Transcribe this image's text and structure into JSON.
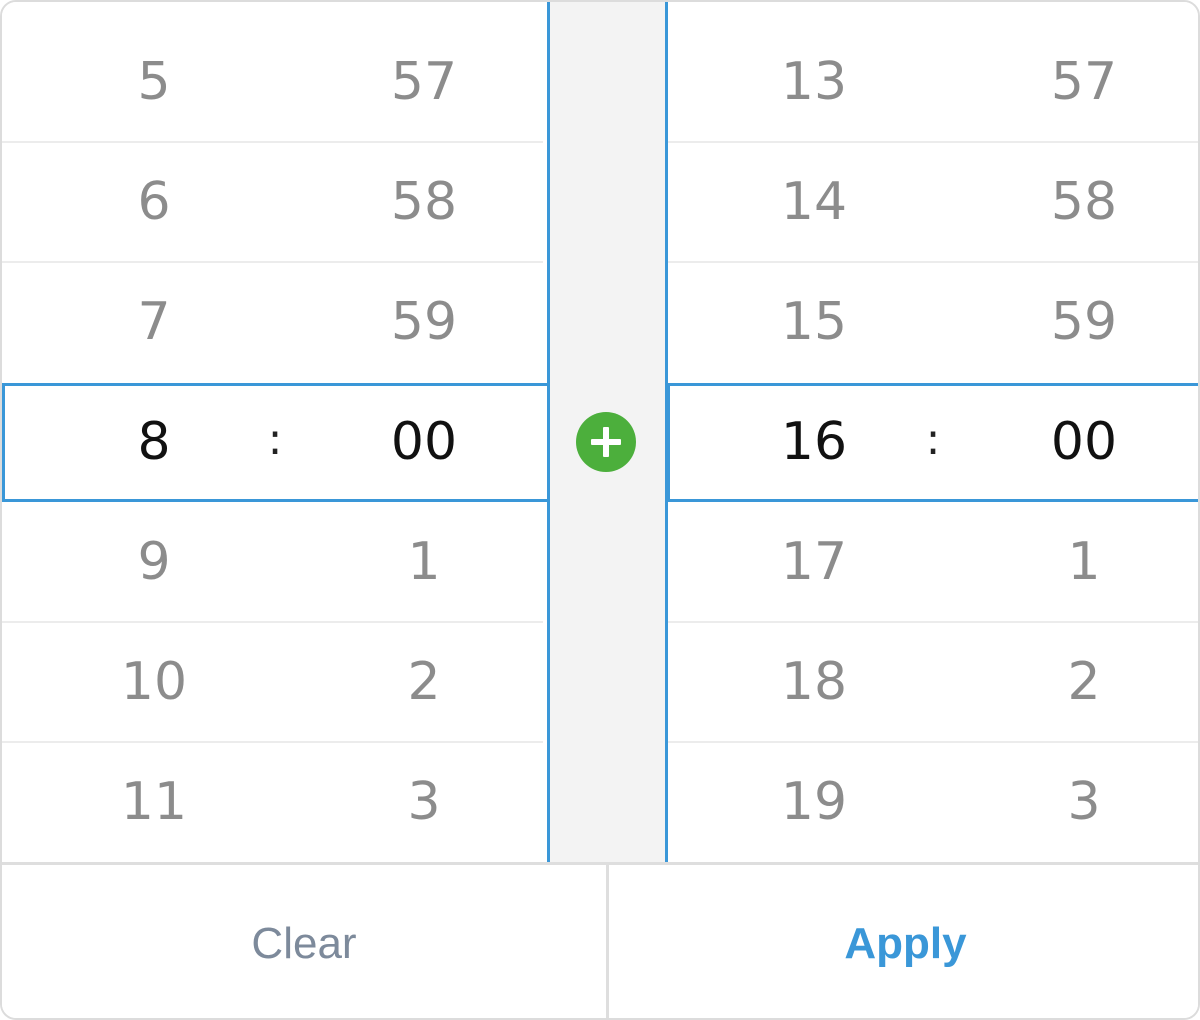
{
  "start_time": {
    "hours_above": [
      "5",
      "6",
      "7"
    ],
    "minutes_above": [
      "57",
      "58",
      "59"
    ],
    "selected_hour": "8",
    "separator": ":",
    "selected_minute": "00",
    "hours_below": [
      "9",
      "10",
      "11"
    ],
    "minutes_below": [
      "1",
      "2",
      "3"
    ]
  },
  "end_time": {
    "hours_above": [
      "13",
      "14",
      "15"
    ],
    "minutes_above": [
      "57",
      "58",
      "59"
    ],
    "selected_hour": "16",
    "separator": ":",
    "selected_minute": "00",
    "hours_below": [
      "17",
      "18",
      "19"
    ],
    "minutes_below": [
      "1",
      "2",
      "3"
    ]
  },
  "add_button": {
    "icon": "plus-circle-icon",
    "color": "#4caf3c"
  },
  "footer": {
    "clear_label": "Clear",
    "apply_label": "Apply"
  },
  "colors": {
    "accent": "#3a97d8",
    "muted_text": "#8c8c8c",
    "selected_text": "#111111"
  }
}
